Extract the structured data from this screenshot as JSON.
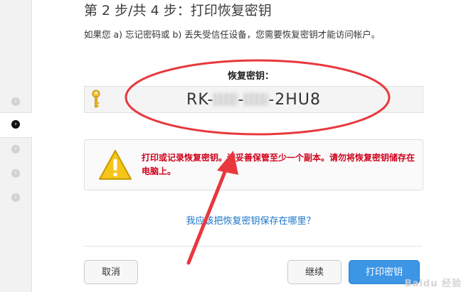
{
  "title": "第 2 步/共 4 步：打印恢复密钥",
  "description": "如果您 a) 忘记密码或 b) 丢失受信任设备，您需要恢复密钥才能访问帐户。",
  "key": {
    "label": "恢复密钥：",
    "prefix": "RK-",
    "sep1": "-",
    "sep2": "-",
    "suffix": "2HU8"
  },
  "warning": {
    "text": "打印或记录恢复密钥。请妥善保管至少一个副本。请勿将恢复密钥储存在电脑上。"
  },
  "link": "我应该把恢复密钥保存在哪里？",
  "buttons": {
    "cancel": "取消",
    "continue": "继续",
    "print": "打印密钥"
  },
  "sidebar_steps": [
    "›",
    "›",
    "›",
    "›",
    "›"
  ],
  "watermark": "Baidu 经验",
  "colors": {
    "warning_text": "#d0021b",
    "link": "#1a73c7",
    "primary_button": "#3d95e6",
    "annotation": "#e8383d"
  }
}
